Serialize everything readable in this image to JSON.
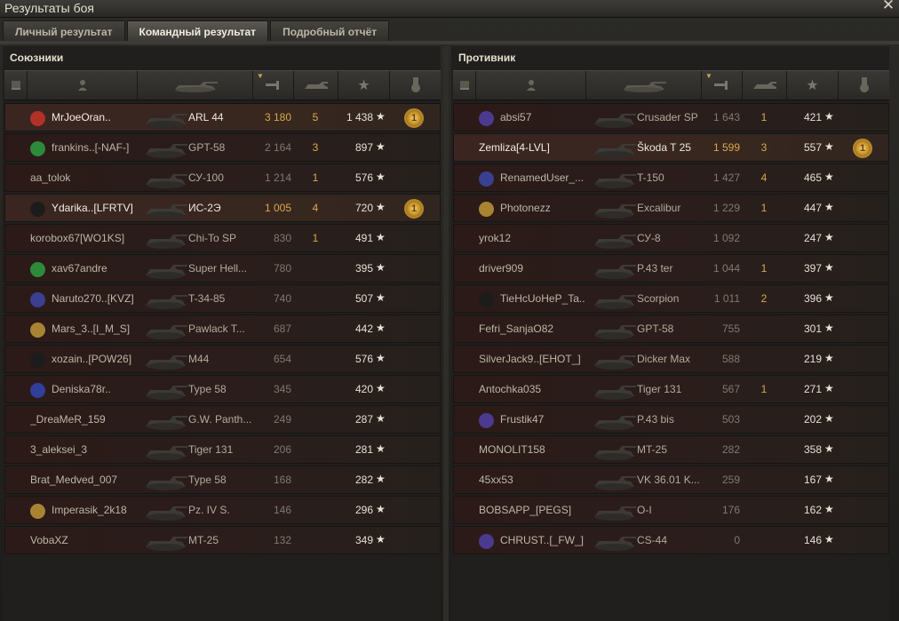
{
  "window": {
    "title": "Результаты боя",
    "close_glyph": "✕"
  },
  "tabs": [
    {
      "label": "Личный результат",
      "active": false
    },
    {
      "label": "Командный результат",
      "active": true
    },
    {
      "label": "Подробный отчёт",
      "active": false
    }
  ],
  "columns": {
    "status_icon": "vehicle-status-icon",
    "player_icon": "player-icon",
    "tank_icon": "tank-icon",
    "damage_icon": "damage-icon",
    "frags_icon": "frags-icon",
    "xp_icon": "star-icon",
    "medal_icon": "medal-icon"
  },
  "allies": {
    "title": "Союзники",
    "rows": [
      {
        "player": "MrJoeOran..",
        "clan_color": "#b03128",
        "tank": "ARL 44",
        "damage": "3 180",
        "frags": "5",
        "xp": "1 438",
        "medal": true,
        "me": true,
        "hi": true
      },
      {
        "player": "frankins..[-NAF-]",
        "clan_color": "#2d8a3a",
        "tank": "GPT-58",
        "damage": "2 164",
        "frags": "3",
        "xp": "897",
        "medal": false,
        "hi": false
      },
      {
        "player": "aa_tolok",
        "clan_color": "",
        "tank": "СУ-100",
        "damage": "1 214",
        "frags": "1",
        "xp": "576",
        "medal": false,
        "hi": false
      },
      {
        "player": "Ydarika..[LFRTV]",
        "clan_color": "#1c1c1c",
        "tank": "ИС-2Э",
        "damage": "1 005",
        "frags": "4",
        "xp": "720",
        "medal": true,
        "me": true,
        "hi": true
      },
      {
        "player": "korobox67[WO1KS]",
        "clan_color": "",
        "tank": "Chi-To SP",
        "damage": "830",
        "frags": "1",
        "xp": "491",
        "medal": false,
        "hi": false
      },
      {
        "player": "xav67andre",
        "clan_color": "#2d8a3a",
        "tank": "Super Hell...",
        "damage": "780",
        "frags": "",
        "xp": "395",
        "medal": false,
        "hi": false
      },
      {
        "player": "Naruto270..[KVZ]",
        "clan_color": "#3b3f8f",
        "tank": "T-34-85",
        "damage": "740",
        "frags": "",
        "xp": "507",
        "medal": false,
        "hi": false
      },
      {
        "player": "Mars_3..[I_M_S]",
        "clan_color": "#a88432",
        "tank": "Pawlack T...",
        "damage": "687",
        "frags": "",
        "xp": "442",
        "medal": false,
        "hi": false
      },
      {
        "player": "xozain..[POW26]",
        "clan_color": "#1c1c1c",
        "tank": "M44",
        "damage": "654",
        "frags": "",
        "xp": "576",
        "medal": false,
        "hi": false
      },
      {
        "player": "Deniska78r..",
        "clan_color": "#2f3f9a",
        "tank": "Type 58",
        "damage": "345",
        "frags": "",
        "xp": "420",
        "medal": false,
        "hi": false
      },
      {
        "player": "_DreaMeR_159",
        "clan_color": "",
        "tank": "G.W. Panth...",
        "damage": "249",
        "frags": "",
        "xp": "287",
        "medal": false,
        "hi": false
      },
      {
        "player": "3_aleksei_3",
        "clan_color": "",
        "tank": "Tiger 131",
        "damage": "206",
        "frags": "",
        "xp": "281",
        "medal": false,
        "hi": false
      },
      {
        "player": "Brat_Medved_007",
        "clan_color": "",
        "tank": "Type 58",
        "damage": "168",
        "frags": "",
        "xp": "282",
        "medal": false,
        "hi": false
      },
      {
        "player": "Imperasik_2k18",
        "clan_color": "#a88432",
        "tank": "Pz. IV S.",
        "damage": "146",
        "frags": "",
        "xp": "296",
        "medal": false,
        "hi": false
      },
      {
        "player": "VobaXZ",
        "clan_color": "",
        "tank": "MT-25",
        "damage": "132",
        "frags": "",
        "xp": "349",
        "medal": false,
        "hi": false
      }
    ]
  },
  "enemies": {
    "title": "Противник",
    "rows": [
      {
        "player": "absi57",
        "clan_color": "#4b3a8f",
        "tank": "Crusader SP",
        "damage": "1 643",
        "frags": "1",
        "xp": "421",
        "medal": false,
        "hi": false
      },
      {
        "player": "Zemliza[4-LVL]",
        "clan_color": "",
        "tank": "Škoda T 25",
        "damage": "1 599",
        "frags": "3",
        "xp": "557",
        "medal": true,
        "me": true,
        "hi": true
      },
      {
        "player": "RenamedUser_...",
        "clan_color": "#3b3f8f",
        "tank": "T-150",
        "damage": "1 427",
        "frags": "4",
        "xp": "465",
        "medal": false,
        "hi": false
      },
      {
        "player": "Photonezz",
        "clan_color": "#a88432",
        "tank": "Excalibur",
        "damage": "1 229",
        "frags": "1",
        "xp": "447",
        "medal": false,
        "hi": false
      },
      {
        "player": "yrok12",
        "clan_color": "",
        "tank": "СУ-8",
        "damage": "1 092",
        "frags": "",
        "xp": "247",
        "medal": false,
        "hi": false
      },
      {
        "player": "driver909",
        "clan_color": "",
        "tank": "P.43 ter",
        "damage": "1 044",
        "frags": "1",
        "xp": "397",
        "medal": false,
        "hi": false
      },
      {
        "player": "TieHcUoHeP_Ta..",
        "clan_color": "#1c1c1c",
        "tank": "Scorpion",
        "damage": "1 011",
        "frags": "2",
        "xp": "396",
        "medal": false,
        "hi": false
      },
      {
        "player": "Fefri_SanjaO82",
        "clan_color": "",
        "tank": "GPT-58",
        "damage": "755",
        "frags": "",
        "xp": "301",
        "medal": false,
        "hi": false
      },
      {
        "player": "SilverJack9..[EHOT_]",
        "clan_color": "",
        "tank": "Dicker Max",
        "damage": "588",
        "frags": "",
        "xp": "219",
        "medal": false,
        "hi": false
      },
      {
        "player": "Antochka035",
        "clan_color": "",
        "tank": "Tiger 131",
        "damage": "567",
        "frags": "1",
        "xp": "271",
        "medal": false,
        "hi": false
      },
      {
        "player": "Frustik47",
        "clan_color": "#4b3a8f",
        "tank": "P.43 bis",
        "damage": "503",
        "frags": "",
        "xp": "202",
        "medal": false,
        "hi": false
      },
      {
        "player": "MONOLIT158",
        "clan_color": "",
        "tank": "MT-25",
        "damage": "282",
        "frags": "",
        "xp": "358",
        "medal": false,
        "hi": false
      },
      {
        "player": "45xx53",
        "clan_color": "",
        "tank": "VK 36.01 K...",
        "damage": "259",
        "frags": "",
        "xp": "167",
        "medal": false,
        "hi": false
      },
      {
        "player": "BOBSAPP_[PEGS]",
        "clan_color": "",
        "tank": "O-I",
        "damage": "176",
        "frags": "",
        "xp": "162",
        "medal": false,
        "hi": false
      },
      {
        "player": "CHRUST..[_FW_]",
        "clan_color": "#4b3a8f",
        "tank": "CS-44",
        "damage": "0",
        "frags": "",
        "xp": "146",
        "medal": false,
        "hi": false
      }
    ]
  },
  "star_glyph": "★"
}
